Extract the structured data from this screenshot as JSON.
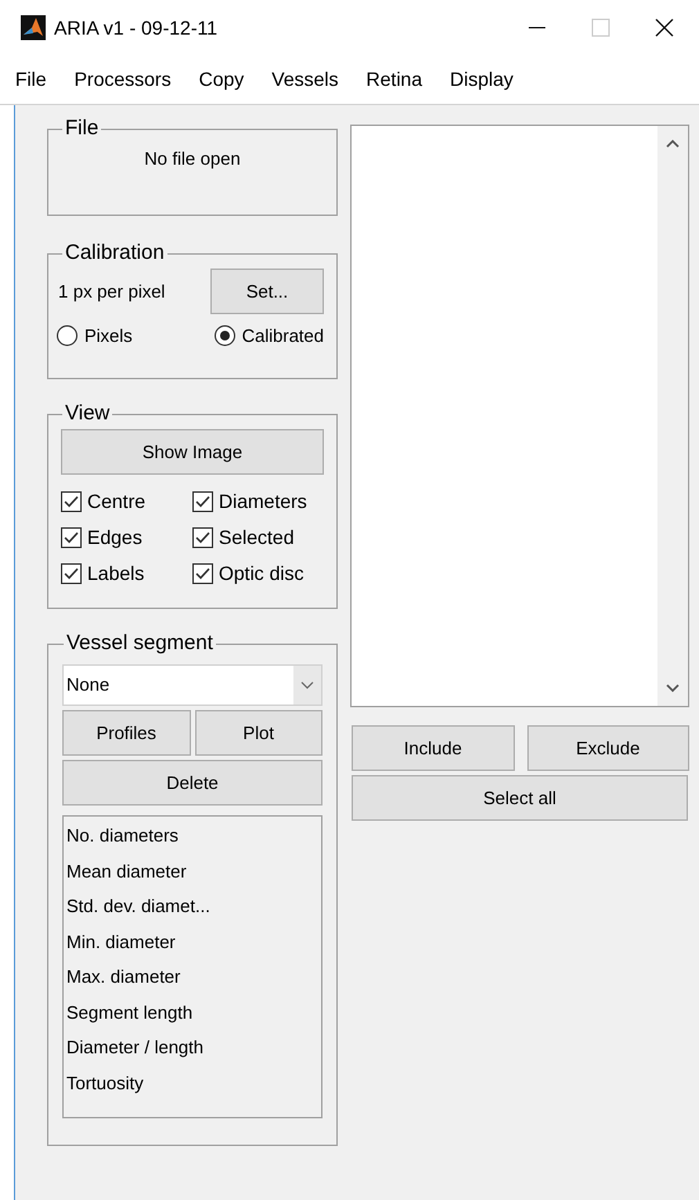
{
  "window": {
    "title": "ARIA v1 - 09-12-11"
  },
  "menu": [
    "File",
    "Processors",
    "Copy",
    "Vessels",
    "Retina",
    "Display"
  ],
  "file_panel": {
    "title": "File",
    "status": "No file open"
  },
  "calibration": {
    "title": "Calibration",
    "reading": "1 px per pixel",
    "set_button": "Set...",
    "options": [
      {
        "label": "Pixels",
        "selected": false
      },
      {
        "label": "Calibrated",
        "selected": true
      }
    ]
  },
  "view": {
    "title": "View",
    "show_button": "Show Image",
    "checks": [
      {
        "label": "Centre",
        "checked": true
      },
      {
        "label": "Diameters",
        "checked": true
      },
      {
        "label": "Edges",
        "checked": true
      },
      {
        "label": "Selected",
        "checked": true
      },
      {
        "label": "Labels",
        "checked": true
      },
      {
        "label": "Optic disc",
        "checked": true
      }
    ]
  },
  "vessel_segment": {
    "title": "Vessel segment",
    "dropdown": "None",
    "buttons": [
      "Profiles",
      "Plot"
    ],
    "delete_button": "Delete",
    "stats": [
      "No. diameters",
      "Mean diameter",
      "Std. dev. diamet...",
      "Min. diameter",
      "Max. diameter",
      "Segment length",
      "Diameter / length",
      "Tortuosity"
    ]
  },
  "list_buttons": [
    "Include",
    "Exclude"
  ],
  "select_all": "Select all"
}
